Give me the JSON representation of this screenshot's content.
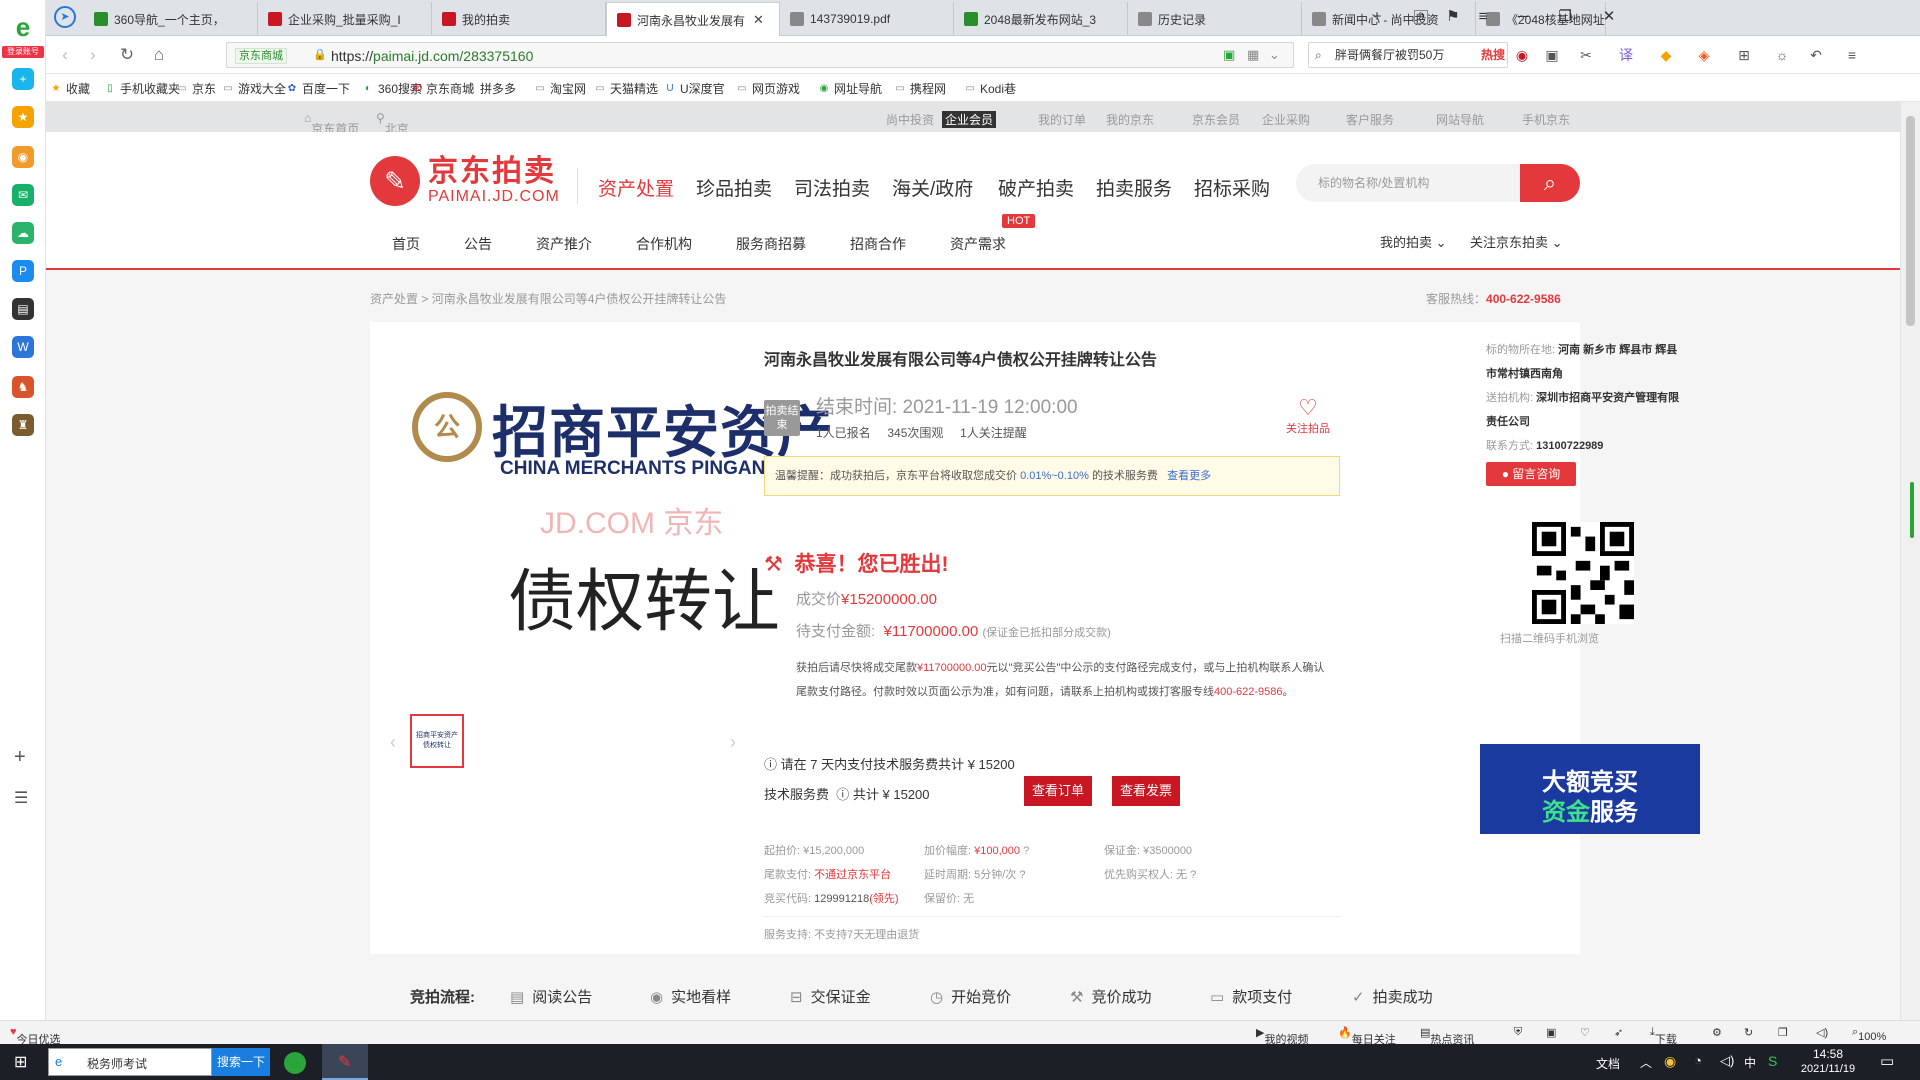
{
  "sidebar": {
    "login_label": "登录账号"
  },
  "tabs": [
    {
      "label": "360导航_一个主页，",
      "color": "#2a8f2a"
    },
    {
      "label": "企业采购_批量采购_I",
      "color": "#c81623"
    },
    {
      "label": "我的拍卖",
      "color": "#c81623"
    },
    {
      "label": "河南永昌牧业发展有",
      "color": "#c81623",
      "active": true
    },
    {
      "label": "143739019.pdf",
      "color": "#888888"
    },
    {
      "label": "2048最新发布网站_3",
      "color": "#2a8f2a"
    },
    {
      "label": "历史记录",
      "color": "#888888"
    },
    {
      "label": "新闻中心 - 尚中投资",
      "color": "#888888"
    },
    {
      "label": "《2048核基地网址最",
      "color": "#888888"
    }
  ],
  "address": {
    "site_badge": "京东商城",
    "url_prefix": "https://",
    "url_main": "paimai.jd.com/283375160",
    "search_text": "胖哥俩餐厅被罚50万",
    "search_hot": "热搜"
  },
  "bookmarks": [
    "收藏",
    "手机收藏夹",
    "京东",
    "游戏大全",
    "百度一下",
    "360搜索",
    "京东商城",
    "拼多多",
    "淘宝网",
    "天猫精选",
    "U深度官",
    "网页游戏",
    "网址导航",
    "携程网",
    "Kodi巷"
  ],
  "jd_top": {
    "home": "京东首页",
    "location": "北京",
    "links": [
      "尚中投资",
      "企业会员",
      "我的订单",
      "我的京东",
      "京东会员",
      "企业采购",
      "客户服务",
      "网站导航",
      "手机京东"
    ]
  },
  "header": {
    "logo_cn": "京东拍卖",
    "logo_en": "PAIMAI.JD.COM",
    "main_nav": [
      "资产处置",
      "珍品拍卖",
      "司法拍卖",
      "海关/政府",
      "破产拍卖",
      "拍卖服务",
      "招标采购"
    ],
    "search_placeholder": "标的物名称/处置机构",
    "sub_nav": [
      "首页",
      "公告",
      "资产推介",
      "合作机构",
      "服务商招募",
      "招商合作",
      "资产需求"
    ],
    "hot_badge": "HOT",
    "my_auction": "我的拍卖",
    "follow_jd": "关注京东拍卖"
  },
  "breadcrumb": {
    "root": "资产处置",
    "sep": " > ",
    "current": "河南永昌牧业发展有限公司等4户债权公开挂牌转让公告"
  },
  "hotline": {
    "label": "客服热线：",
    "number": "400-622-9586"
  },
  "image": {
    "cn": "招商平安资产",
    "en": "CHINA MERCHANTS PINGAN AMC",
    "watermark": "JD.COM 京东",
    "title": "债权转让"
  },
  "item": {
    "title": "河南永昌牧业发展有限公司等4户债权公开挂牌转让公告",
    "status_badge": "拍卖结束",
    "end_time": "结束时间: 2021-11-19 12:00:00",
    "registered": "1人已报名",
    "views": "345次围观",
    "reminders": "1人关注提醒",
    "follow_label": "关注拍品",
    "tip_text": "温馨提醒：成功获拍后，京东平台将收取您成交价",
    "tip_rate": "0.01%~0.10%",
    "tip_suffix": "的技术服务费",
    "tip_more": "查看更多",
    "win_text": "恭喜！您已胜出!",
    "deal_label": "成交价",
    "deal_price": "¥15200000.00",
    "pay_label": "待支付金额:",
    "pay_amount": "¥11700000.00",
    "pay_note": "(保证金已抵扣部分成交款)",
    "instr_1": "获拍后请尽快将成交尾款",
    "instr_amount": "¥11700000.00",
    "instr_2": "元以\"竞买公告\"中公示的支付路径完成支付，或与上拍机构联系人确认尾款支付路径。付款时效以页面公示为准，如有问题，请联系上拍机构或拨打客服专线",
    "instr_phone": "400-622-9586",
    "instr_end": "。",
    "fee_notice": "请在 7 天内支付技术服务费共计 ¥ 15200",
    "fee_label": "技术服务费",
    "fee_total": "共计 ¥ 15200",
    "btn_order": "查看订单",
    "btn_invoice": "查看发票"
  },
  "params": {
    "start_price": "起拍价: ¥15,200,000",
    "increment_label": "加价幅度:",
    "increment": "¥100,000",
    "deposit": "保证金: ¥3500000",
    "tail_label": "尾款支付:",
    "tail": "不通过京东平台",
    "delay": "延时周期: 5分钟/次",
    "priority": "优先购买权人: 无",
    "bid_code_label": "竞买代码:",
    "bid_code": "129991218",
    "bid_code_lead": "(领先)",
    "reserve": "保留价: 无",
    "service": "服务支持:  不支持7天无理由退货"
  },
  "side": {
    "location_label": "标的物所在地:",
    "location": "河南 新乡市 辉县市 辉县市常村镇西南角",
    "org_label": "送拍机构:",
    "org": "深圳市招商平安资产管理有限责任公司",
    "contact_label": "联系方式:",
    "contact": "13100722989",
    "consult_btn": "留言咨询",
    "qr_caption": "扫描二维码手机浏览",
    "banner_1": "大额竞买",
    "banner_2a": "资金",
    "banner_2b": "服务"
  },
  "flow": {
    "heading": "竞拍流程:",
    "steps": [
      "阅读公告",
      "实地看样",
      "交保证金",
      "开始竞价",
      "竞价成功",
      "款项支付",
      "拍卖成功"
    ]
  },
  "statusbar": {
    "left": "今日优选",
    "items": [
      "我的视频",
      "每日关注",
      "热点资讯"
    ],
    "download": "下载",
    "zoom": "100%"
  },
  "taskbar": {
    "search_text": "税务师考试",
    "search_btn": "搜索一下",
    "doc": "文档",
    "ime": "中",
    "time": "14:58",
    "date": "2021/11/19"
  }
}
